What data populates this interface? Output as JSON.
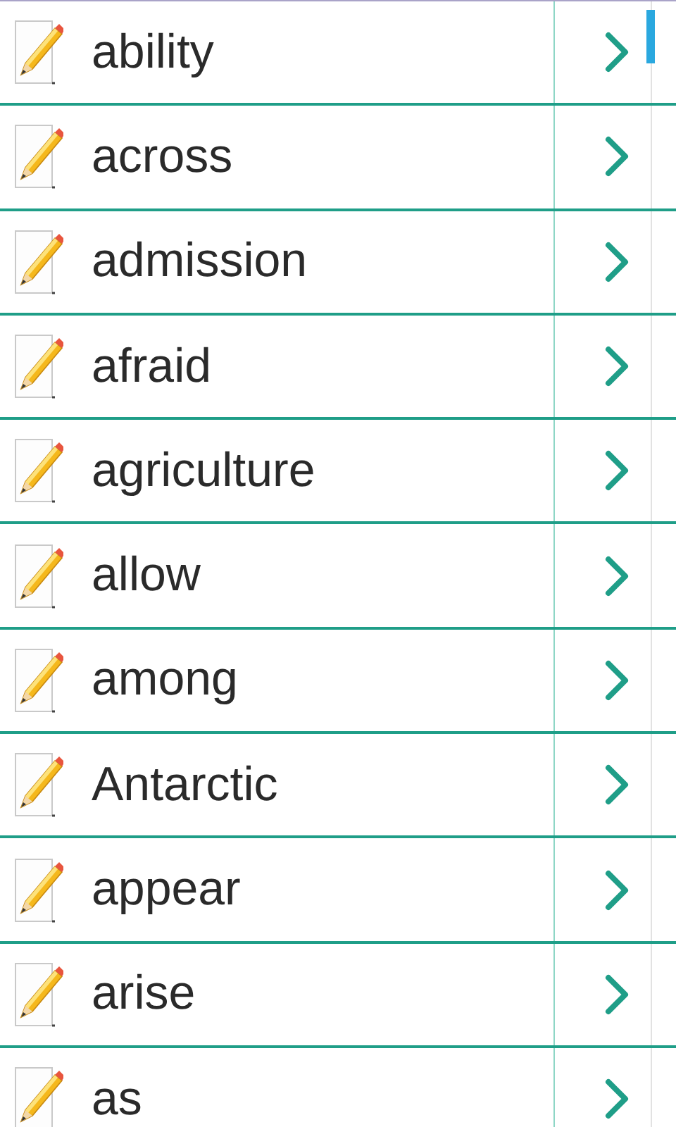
{
  "words": [
    {
      "word": "ability"
    },
    {
      "word": "across"
    },
    {
      "word": "admission"
    },
    {
      "word": "afraid"
    },
    {
      "word": "agriculture"
    },
    {
      "word": "allow"
    },
    {
      "word": "among"
    },
    {
      "word": "Antarctic"
    },
    {
      "word": "appear"
    },
    {
      "word": "arise"
    },
    {
      "word": "as"
    }
  ]
}
